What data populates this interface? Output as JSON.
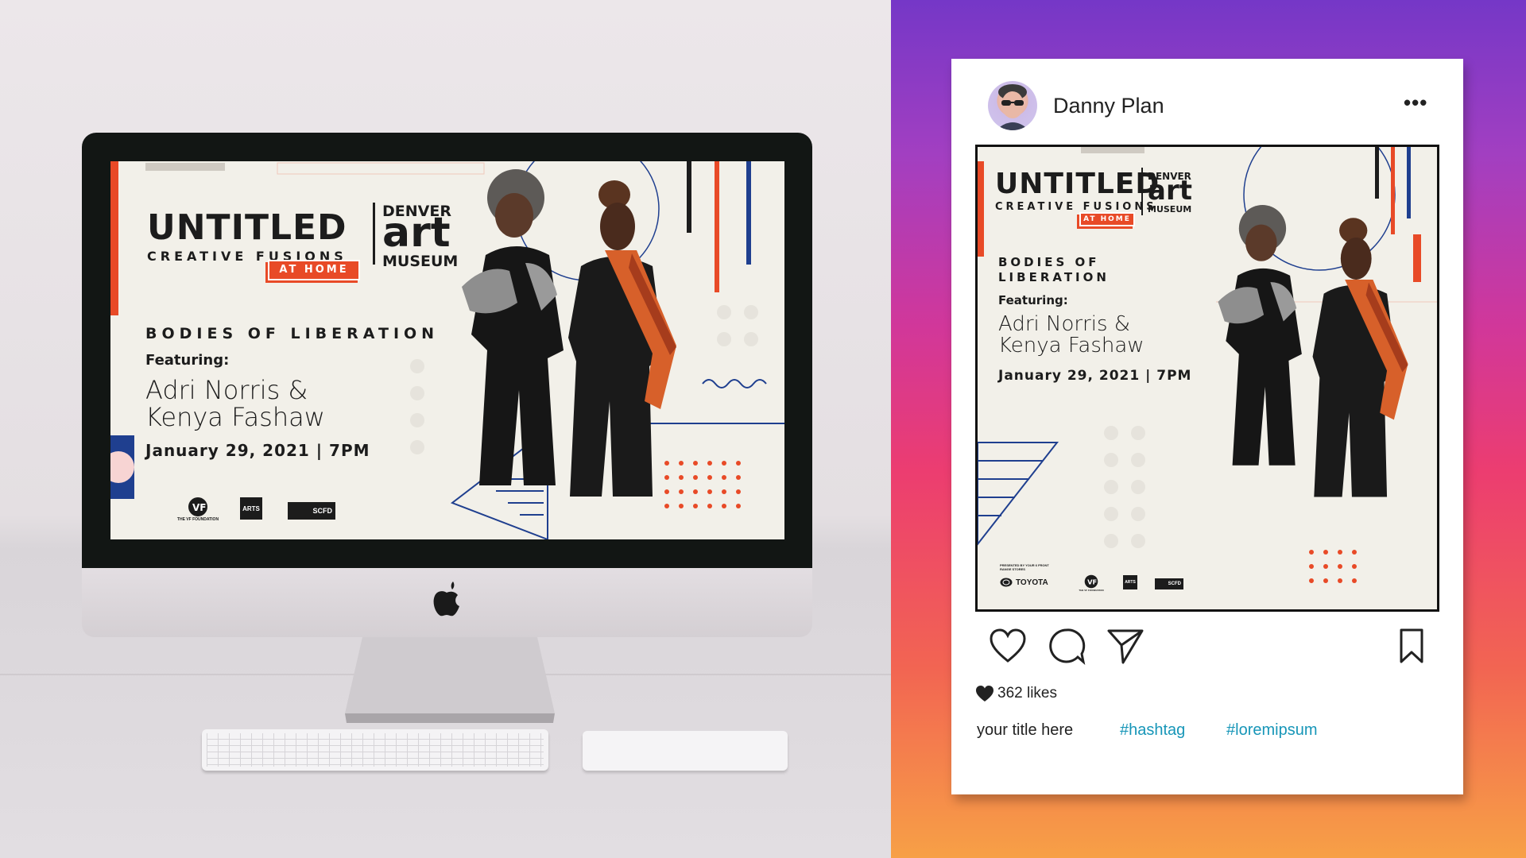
{
  "poster": {
    "title": "UNTITLED",
    "subtitle": "CREATIVE FUSIONS",
    "badge": "AT HOME",
    "museum_top": "DENVER",
    "museum_mid": "art",
    "museum_bottom": "MUSEUM",
    "event": "BODIES OF LIBERATION",
    "featuring": "Featuring:",
    "names_line1": "Adri Norris &",
    "names_line2": "Kenya Fashaw",
    "date": "January 29, 2021 | 7PM",
    "sponsor_vf": "THE VF FOUNDATION",
    "sponsor_nea": "ARTS",
    "sponsor_scfd": "SCFD",
    "sponsor_toyota": "TOYOTA",
    "sponsor_presented": "PRESENTED BY YOUR 6 FRONT RANGE STORES"
  },
  "instagram": {
    "username": "Danny Plan",
    "more_icon": "ellipsis-icon",
    "likes": "362 likes",
    "caption_title": "your title here",
    "hashtag1": "#hashtag",
    "hashtag2": "#loremipsum"
  },
  "colors": {
    "accent_red": "#e84a27",
    "accent_blue": "#1f3f8f",
    "hashtag_blue": "#1796b8",
    "poster_bg": "#f2f0e9"
  }
}
